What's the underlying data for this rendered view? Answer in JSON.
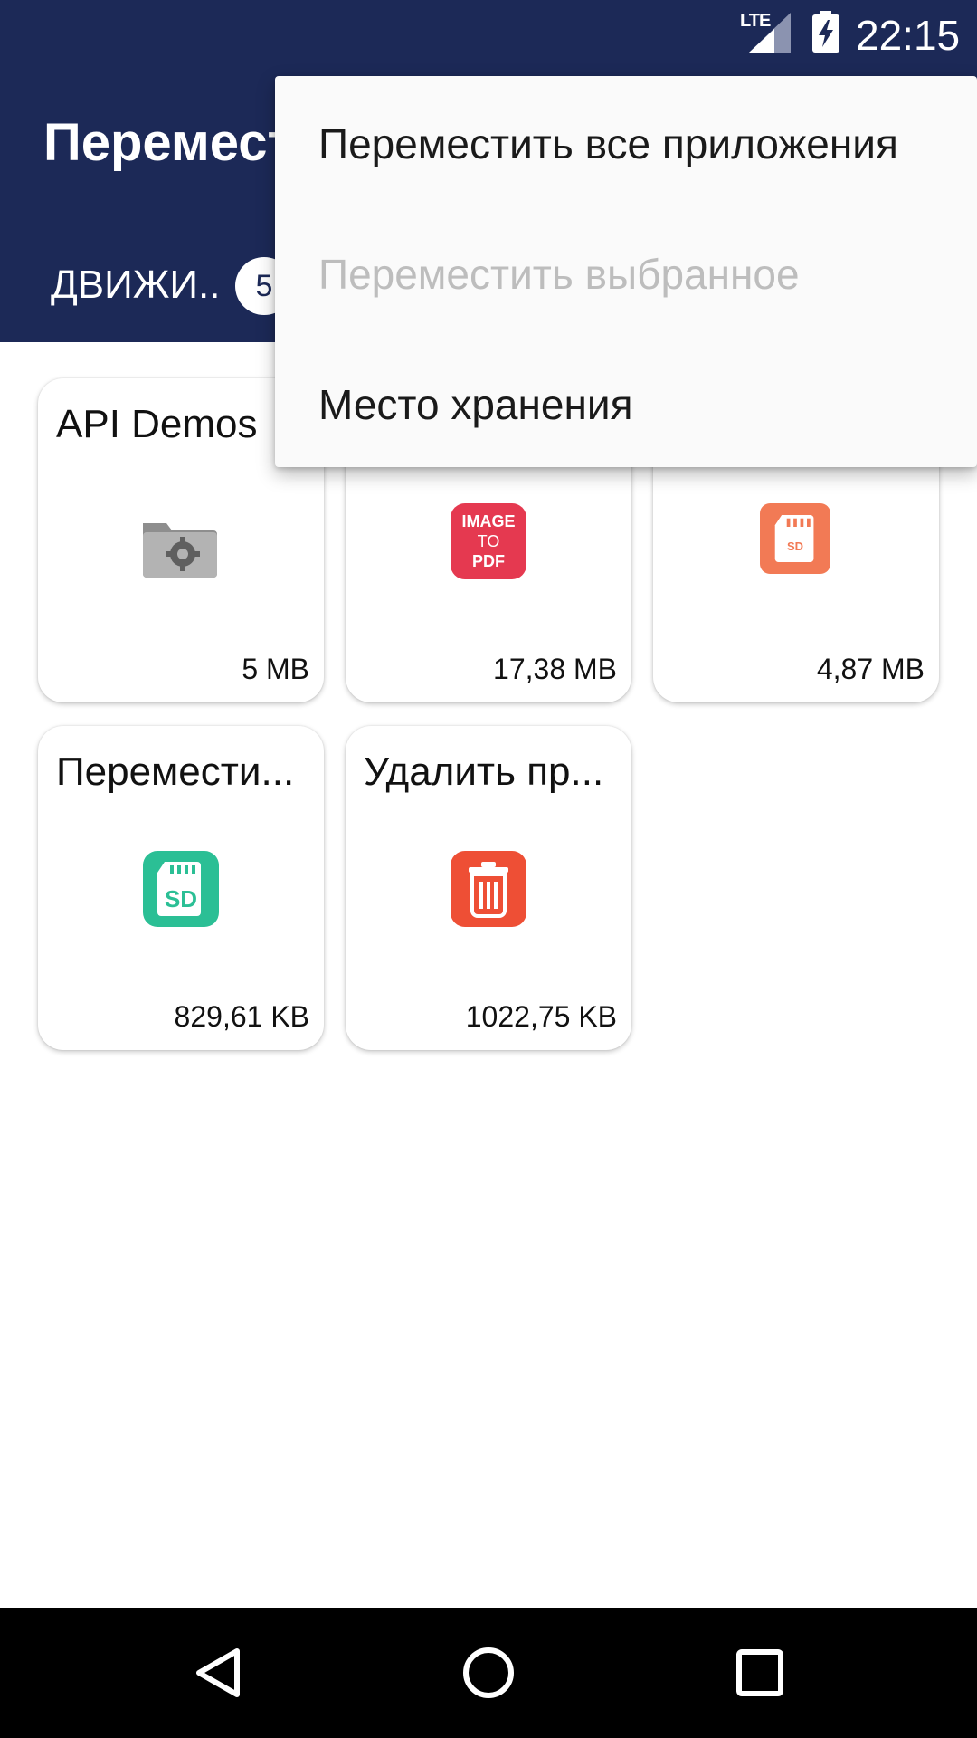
{
  "status_bar": {
    "time": "22:15",
    "network": "LTE",
    "signal_icon": "signal-icon",
    "battery_icon": "battery-charging-icon"
  },
  "toolbar": {
    "title": "Перемест"
  },
  "tabs": [
    {
      "label": "ДВИЖИ..",
      "badge": "5"
    }
  ],
  "apps": [
    {
      "name": "API Demos",
      "size": "5 MB",
      "icon": "settings-folder-icon"
    },
    {
      "name": "",
      "size": "17,38 MB",
      "icon": "image-to-pdf-icon",
      "icon_text": [
        "IMAGE",
        "TO",
        "PDF"
      ],
      "color": "#e53950"
    },
    {
      "name": "",
      "size": "4,87 MB",
      "icon": "sd-card-icon",
      "icon_text": "SD",
      "color": "#f27a55"
    },
    {
      "name": "Перемести...",
      "size": "829,61 KB",
      "icon": "sd-card-icon",
      "icon_text": "SD",
      "color": "#2bbf95"
    },
    {
      "name": "Удалить пр...",
      "size": "1022,75 KB",
      "icon": "trash-icon",
      "color": "#ee4f35"
    }
  ],
  "overflow_menu": {
    "items": [
      {
        "label": "Переместить все приложения",
        "enabled": true
      },
      {
        "label": "Переместить выбранное",
        "enabled": false
      },
      {
        "label": "Место хранения",
        "enabled": true
      }
    ]
  },
  "nav_bar": {
    "back_icon": "back-icon",
    "home_icon": "home-icon",
    "recents_icon": "recents-icon"
  },
  "colors": {
    "primary": "#1c2957",
    "menu_bg": "#fafafa",
    "disabled_text": "#bdbdbd"
  }
}
